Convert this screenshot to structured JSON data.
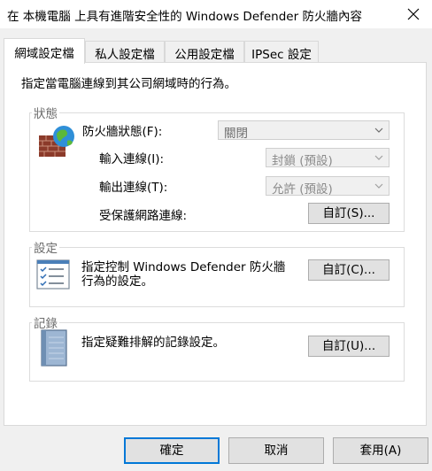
{
  "window": {
    "title": "在 本機電腦 上具有進階安全性的 Windows Defender 防火牆內容"
  },
  "tabs": [
    {
      "label": "網域設定檔"
    },
    {
      "label": "私人設定檔"
    },
    {
      "label": "公用設定檔"
    },
    {
      "label": "IPSec 設定"
    }
  ],
  "domain_profile": {
    "description": "指定當電腦連線到其公司網域時的行為。",
    "state": {
      "caption": "狀態",
      "firewall_state_label": "防火牆狀態(F):",
      "firewall_state_value": "關閉",
      "inbound_label": "輸入連線(I):",
      "inbound_value": "封鎖 (預設)",
      "outbound_label": "輸出連線(T):",
      "outbound_value": "允許 (預設)",
      "protected_connections_label": "受保護網路連線:",
      "protected_connections_button": "自訂(S)..."
    },
    "settings": {
      "caption": "設定",
      "description_line1": "指定控制 Windows Defender 防火牆",
      "description_line2": "行為的設定。",
      "button": "自訂(C)..."
    },
    "logging": {
      "caption": "記錄",
      "description": "指定疑難排解的記錄設定。",
      "button": "自訂(U)..."
    }
  },
  "footer": {
    "ok": "確定",
    "cancel": "取消",
    "apply": "套用(A)"
  },
  "icons": {
    "close": "close-icon",
    "firewall": "firewall-globe-icon",
    "settings": "checklist-icon",
    "logging": "notebook-icon"
  },
  "colors": {
    "accent": "#0078d7",
    "window_bg": "#f0f0f0",
    "panel_bg": "#ffffff",
    "caption_gray": "#6d6d6d"
  }
}
